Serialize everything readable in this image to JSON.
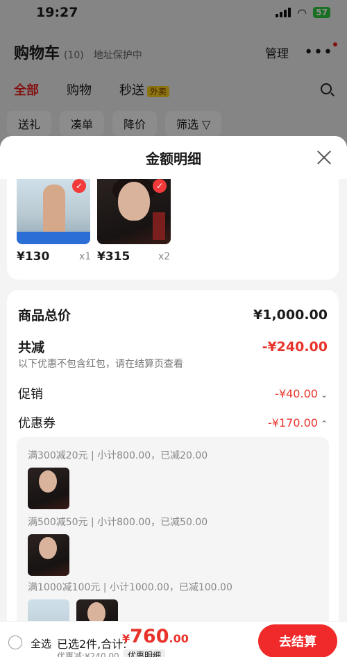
{
  "status": {
    "time": "19:27",
    "battery": "57"
  },
  "header": {
    "title": "购物车",
    "count": "(10)",
    "address": "地址保护中",
    "manage": "管理"
  },
  "tabs": {
    "all": "全部",
    "shopping": "购物",
    "flash": "秒送",
    "flash_tag": "外卖"
  },
  "filters": [
    "送礼",
    "凑单",
    "降价",
    "筛选"
  ],
  "sheet": {
    "title": "金额明细",
    "products": [
      {
        "price": "¥130",
        "qty": "x1"
      },
      {
        "price": "¥315",
        "qty": "x2"
      }
    ],
    "total_label": "商品总价",
    "total_value": "¥1,000.00",
    "reduce_label": "共减",
    "reduce_value": "-¥240.00",
    "reduce_note": "以下优惠不包含红包，请在结算页查看",
    "promo_label": "促销",
    "promo_value": "-¥40.00",
    "coupon_label": "优惠券",
    "coupon_value": "-¥170.00",
    "coupon_lines": [
      "满300减20元 | 小计800.00，已减20.00",
      "满500减50元 | 小计800.00，已减50.00",
      "满1000减100元 | 小计1000.00，已减100.00"
    ]
  },
  "bottom": {
    "select_all": "全选",
    "selected": "已选2件,合计:",
    "currency": "¥",
    "amount_big": "760",
    "amount_small": ".00",
    "discount": "优惠减:¥240.00",
    "detail": "优惠明细",
    "checkout": "去结算"
  },
  "colors": {
    "accent": "#e8332b",
    "button": "#f02a2a"
  },
  "icons": [
    "location-arrow-icon",
    "signal-icon",
    "wifi-icon",
    "battery-icon",
    "shield-icon",
    "search-icon",
    "filter-icon",
    "close-icon",
    "check-icon",
    "chevron-down-icon",
    "chevron-up-icon"
  ]
}
